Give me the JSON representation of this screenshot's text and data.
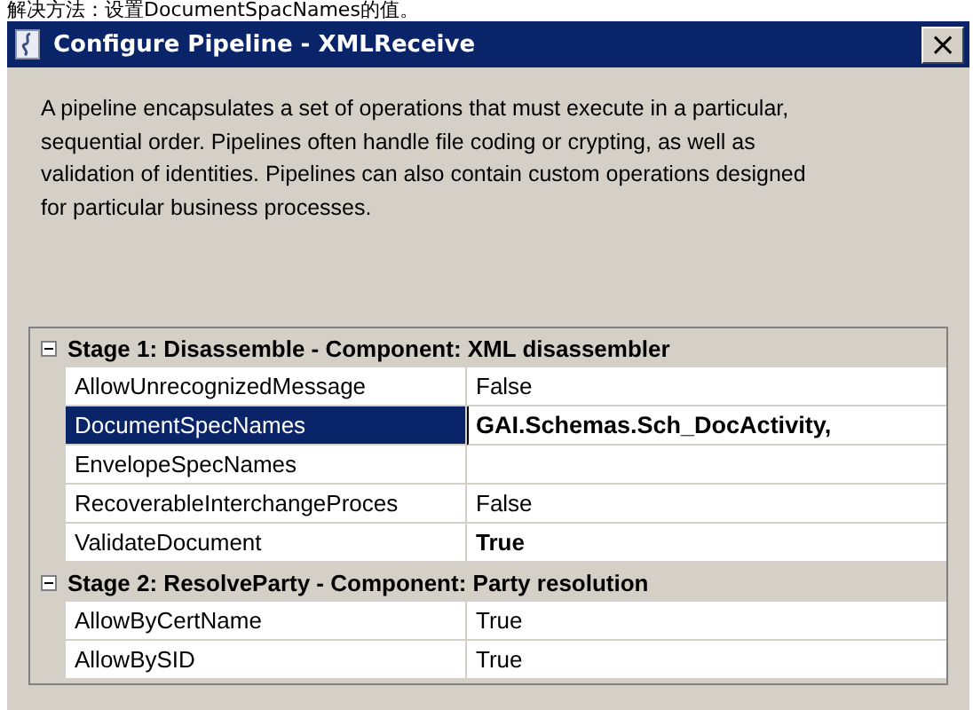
{
  "caption": "解决方法：设置DocumentSpacNames的值。",
  "window": {
    "title": "Configure Pipeline - XMLReceive",
    "close": "×"
  },
  "description": "A pipeline encapsulates a set of operations that must execute in a particular, sequential order. Pipelines often handle file coding or crypting, as well as validation of identities. Pipelines can also contain custom operations designed for particular business processes.",
  "stages": [
    {
      "title": "Stage 1: Disassemble - Component: XML disassembler",
      "expanded": true,
      "properties": [
        {
          "name": "AllowUnrecognizedMessage",
          "value": "False",
          "selected": false,
          "modified": false,
          "kind": "text"
        },
        {
          "name": "DocumentSpecNames",
          "value": "GAI.Schemas.Sch_DocActivity,",
          "selected": true,
          "modified": true,
          "kind": "editing"
        },
        {
          "name": "EnvelopeSpecNames",
          "selected": false,
          "modified": false,
          "kind": "text"
        },
        {
          "name": "RecoverableInterchangeProces",
          "value": "False",
          "selected": false,
          "modified": false,
          "kind": "text"
        },
        {
          "name": "ValidateDocument",
          "value": "True",
          "selected": false,
          "modified": true,
          "kind": "text"
        }
      ]
    },
    {
      "title": "Stage 2: ResolveParty - Component: Party resolution",
      "expanded": true,
      "properties": [
        {
          "name": "AllowByCertName",
          "value": "True",
          "selected": false,
          "modified": false,
          "kind": "text"
        },
        {
          "name": "AllowBySID",
          "value": "True",
          "selected": false,
          "modified": false,
          "kind": "text"
        }
      ]
    }
  ]
}
